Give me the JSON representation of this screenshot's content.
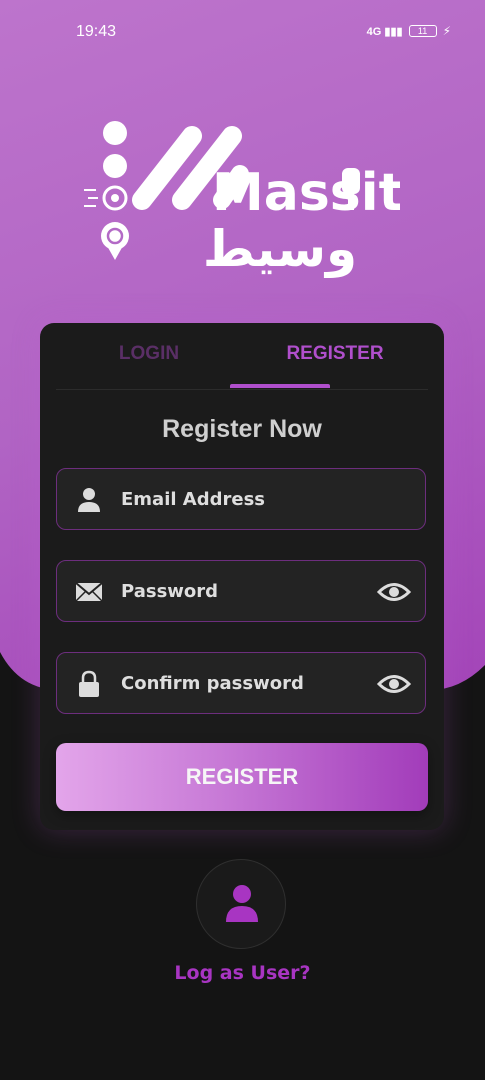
{
  "status_bar": {
    "time": "19:43",
    "signal": "4G",
    "battery": "11"
  },
  "logo": {
    "brand_text": "Massit",
    "arabic_text": "وسيط"
  },
  "tabs": [
    {
      "label": "LOGIN",
      "active": false
    },
    {
      "label": "REGISTER",
      "active": true
    }
  ],
  "form": {
    "heading": "Register Now",
    "fields": [
      {
        "label": "Email Address",
        "icon": "person-icon"
      },
      {
        "label": "Password",
        "icon": "envelope-icon",
        "toggle_icon": "eye-icon"
      },
      {
        "label": "Confirm password",
        "icon": "lock-icon",
        "toggle_icon": "eye-icon"
      }
    ],
    "submit_label": "REGISTER"
  },
  "footer": {
    "link_label": "Log as User?",
    "icon": "user-icon"
  },
  "colors": {
    "accent": "#A835C2",
    "card": "#1B1B1B",
    "background": "#141414",
    "field_border": "#6D2E7E"
  }
}
